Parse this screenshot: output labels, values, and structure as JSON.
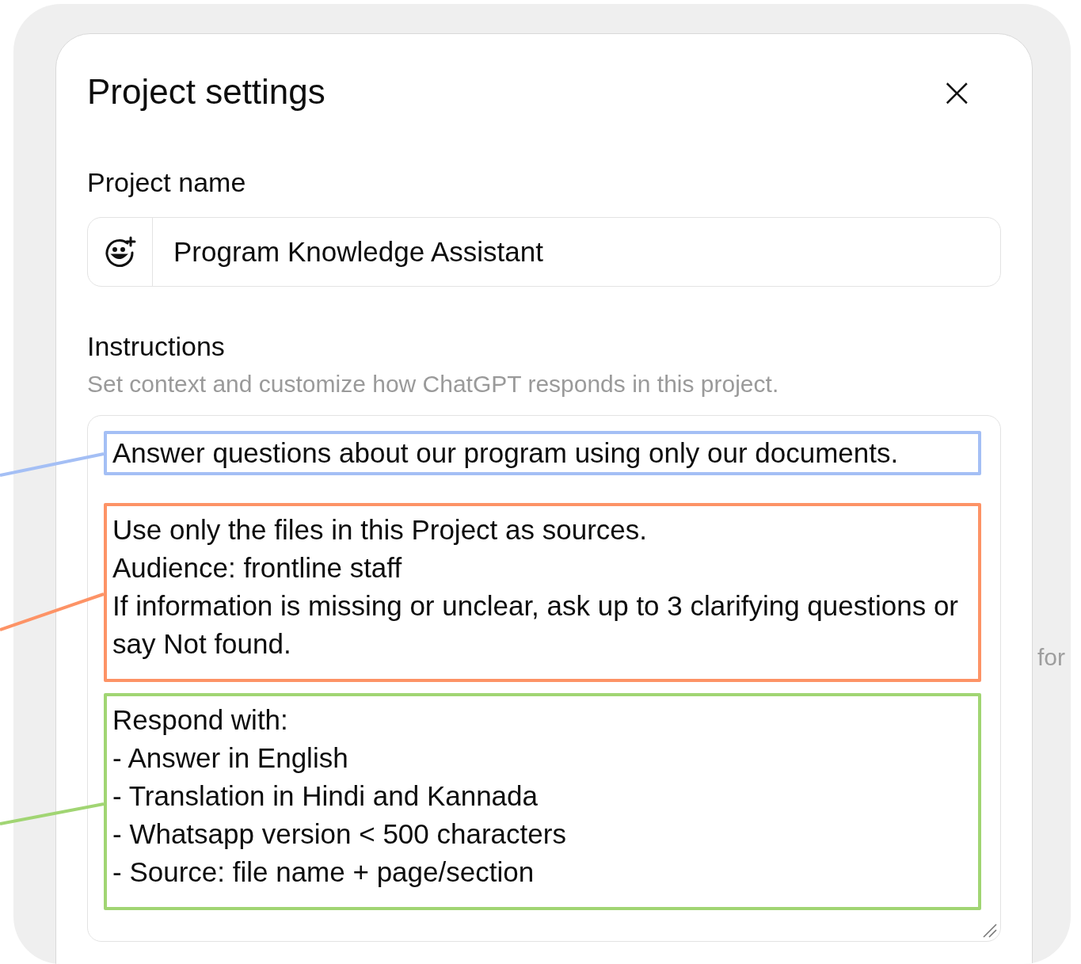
{
  "dialog": {
    "title": "Project settings",
    "close_label": "×"
  },
  "project_name": {
    "label": "Project name",
    "value": "Program Knowledge Assistant"
  },
  "instructions": {
    "label": "Instructions",
    "hint": "Set context and customize how ChatGPT responds in this project.",
    "blocks": [
      {
        "color": "#a4bff5",
        "lines": [
          "Answer questions about our program using only our documents."
        ]
      },
      {
        "color": "#fd9366",
        "lines": [
          "Use only the files in this Project as sources.",
          "Audience: frontline staff",
          "If information is missing or unclear, ask up to 3 clarifying questions or say Not found."
        ]
      },
      {
        "color": "#a1d573",
        "lines": [
          "Respond with:",
          "- Answer in English",
          "- Translation in Hindi and Kannada",
          "- Whatsapp version < 500 characters",
          "- Source: file name + page/section"
        ]
      }
    ]
  },
  "background_text": "for"
}
